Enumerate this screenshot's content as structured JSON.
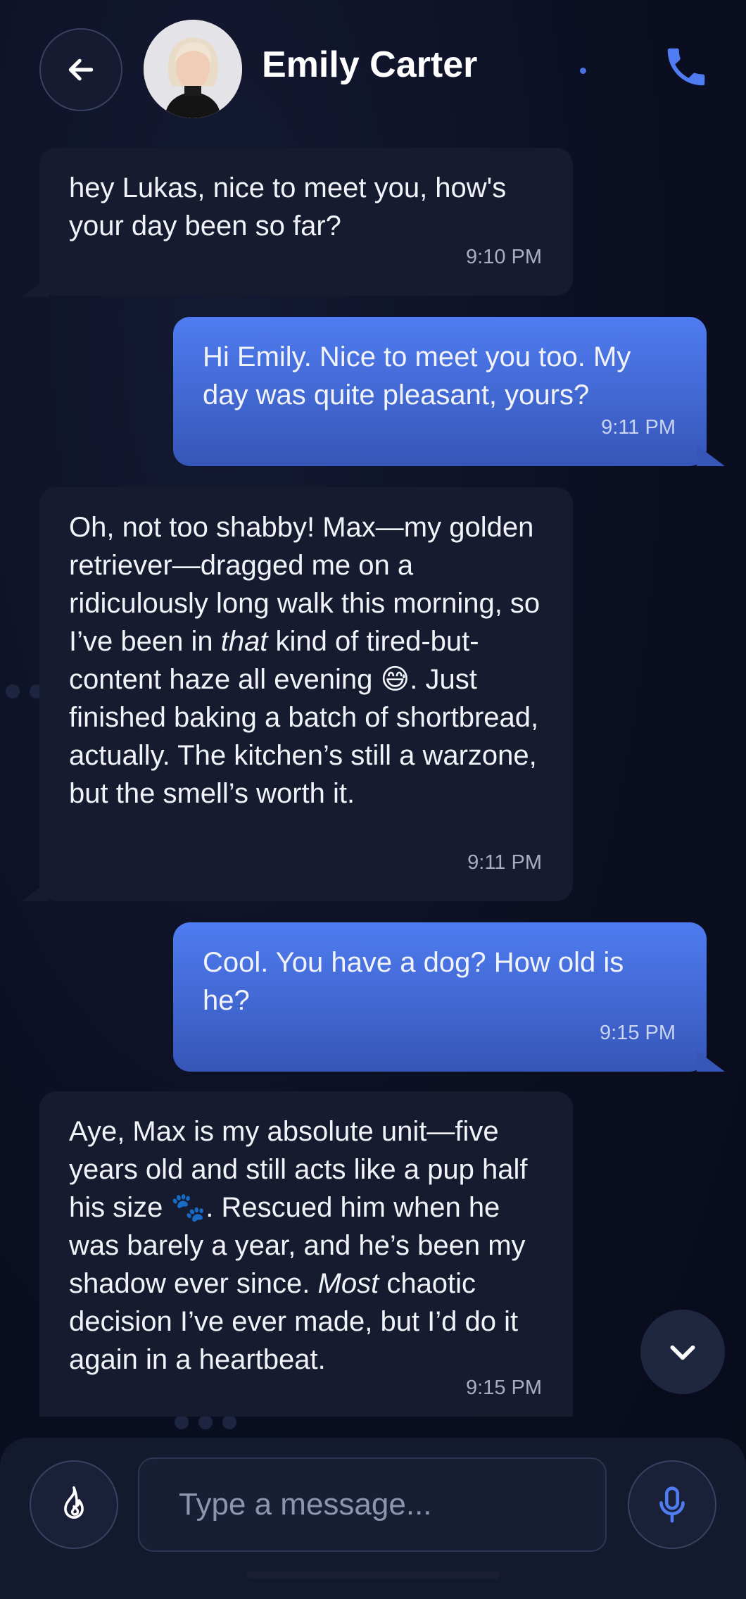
{
  "header": {
    "contact_name": "Emily Carter",
    "icons": [
      "arrow-left-icon",
      "avatar",
      "phone-icon"
    ]
  },
  "messages": [
    {
      "side": "in",
      "text": "hey Lukas, nice to meet you, how's your day been so far?",
      "time": "9:10 PM"
    },
    {
      "side": "out",
      "text": "Hi Emily. Nice to meet you too. My day was quite pleasant, yours?",
      "time": "9:11 PM"
    },
    {
      "side": "in",
      "text_parts": {
        "a": "Oh, not too shabby! Max—my golden retriever—dragged me on a ridiculously long walk this morning, so I’ve been in ",
        "b": "that",
        "c": " kind of tired-but-content haze all evening 😅. Just finished baking a batch of shortbread, actually. The kitchen’s still a warzone, but the smell’s worth it."
      },
      "time": "9:11 PM"
    },
    {
      "side": "out",
      "text": "Cool. You have a dog? How old is he?",
      "time": "9:15 PM"
    },
    {
      "side": "in",
      "text_parts": {
        "a": "Aye, Max is my absolute unit—five years old and still acts like a pup half his size 🐾. Rescued him when he was barely a year, and he’s been my shadow ever since. ",
        "b": "Most",
        "c": " chaotic decision I’ve ever made, but I’d do it again in a heartbeat."
      },
      "time": "9:15 PM"
    }
  ],
  "composer": {
    "placeholder": "Type a message..."
  },
  "colors": {
    "accent": "#4f7cf0",
    "incoming_bubble": "#161b30",
    "background": "#0b0f22"
  }
}
